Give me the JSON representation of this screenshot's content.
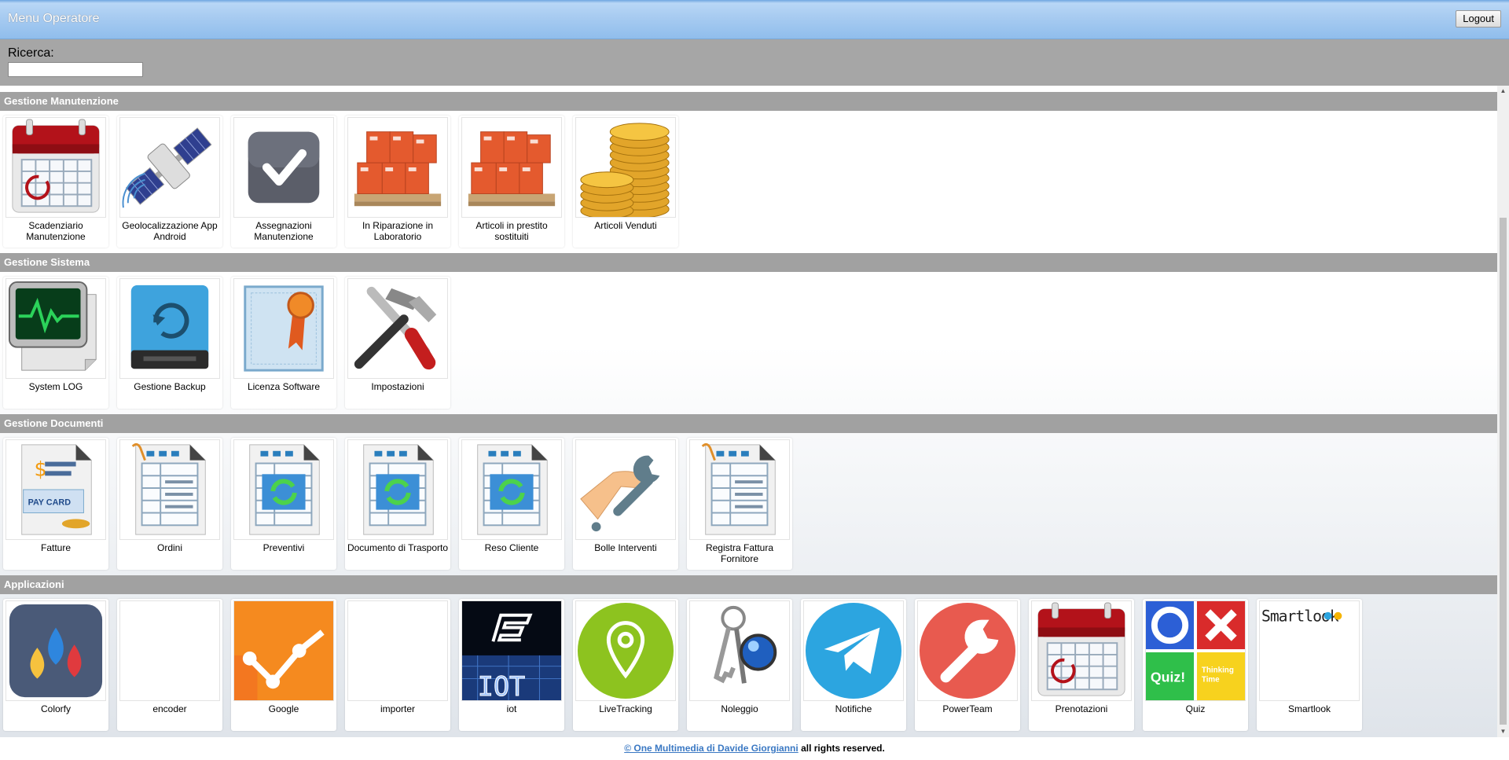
{
  "header": {
    "title": "Menu Operatore",
    "logout_label": "Logout"
  },
  "search": {
    "label": "Ricerca:",
    "value": ""
  },
  "sections": [
    {
      "title": "Gestione Manutenzione",
      "items": [
        {
          "label": "Scadenziario Manutenzione",
          "icon": "calendar-icon"
        },
        {
          "label": "Geolocalizzazione App Android",
          "icon": "satellite-icon"
        },
        {
          "label": "Assegnazioni Manutenzione",
          "icon": "checkmark-icon"
        },
        {
          "label": "In Riparazione in Laboratorio",
          "icon": "boxes-pallet-icon"
        },
        {
          "label": "Articoli in prestito sostituiti",
          "icon": "boxes-pallet-icon"
        },
        {
          "label": "Articoli Venduti",
          "icon": "gold-coins-icon"
        }
      ]
    },
    {
      "title": "Gestione Sistema",
      "items": [
        {
          "label": "System LOG",
          "icon": "monitor-log-icon"
        },
        {
          "label": "Gestione Backup",
          "icon": "backup-drive-icon"
        },
        {
          "label": "Licenza Software",
          "icon": "certificate-icon"
        },
        {
          "label": "Impostazioni",
          "icon": "tools-icon"
        }
      ]
    },
    {
      "title": "Gestione Documenti",
      "items": [
        {
          "label": "Fatture",
          "icon": "pay-card-document-icon"
        },
        {
          "label": "Ordini",
          "icon": "spreadsheet-document-icon"
        },
        {
          "label": "Preventivi",
          "icon": "sync-document-icon"
        },
        {
          "label": "Documento di Trasporto",
          "icon": "sync-document-icon"
        },
        {
          "label": "Reso Cliente",
          "icon": "sync-document-icon"
        },
        {
          "label": "Bolle Interventi",
          "icon": "hand-wrench-icon"
        },
        {
          "label": "Registra Fattura Fornitore",
          "icon": "spreadsheet-document-icon"
        }
      ]
    },
    {
      "title": "Applicazioni",
      "items": [
        {
          "label": "Colorfy",
          "icon": "colorfy-drops-icon"
        },
        {
          "label": "encoder",
          "icon": "blank-icon"
        },
        {
          "label": "Google",
          "icon": "analytics-chart-icon"
        },
        {
          "label": "importer",
          "icon": "blank-icon"
        },
        {
          "label": "iot",
          "icon": "iot-board-icon"
        },
        {
          "label": "LiveTracking",
          "icon": "location-pin-icon"
        },
        {
          "label": "Noleggio",
          "icon": "keys-icon"
        },
        {
          "label": "Notifiche",
          "icon": "telegram-plane-icon"
        },
        {
          "label": "PowerTeam",
          "icon": "wrench-circle-icon"
        },
        {
          "label": "Prenotazioni",
          "icon": "calendar-icon"
        },
        {
          "label": "Quiz",
          "icon": "quiz-grid-icon",
          "texts": {
            "quiz": "Quiz!",
            "thinking": "Thinking",
            "time": "Time"
          }
        },
        {
          "label": "Smartlook",
          "icon": "smartlook-logo-icon",
          "logo_text": "Smartlook"
        }
      ]
    }
  ],
  "footer": {
    "link_text": "© One Multimedia di Davide Giorgianni",
    "suffix": " all rights reserved."
  },
  "colors": {
    "header": "#a9ccf1",
    "section": "#a1a1a1",
    "searchbar": "#a6a6a6",
    "link": "#3a78c3"
  }
}
